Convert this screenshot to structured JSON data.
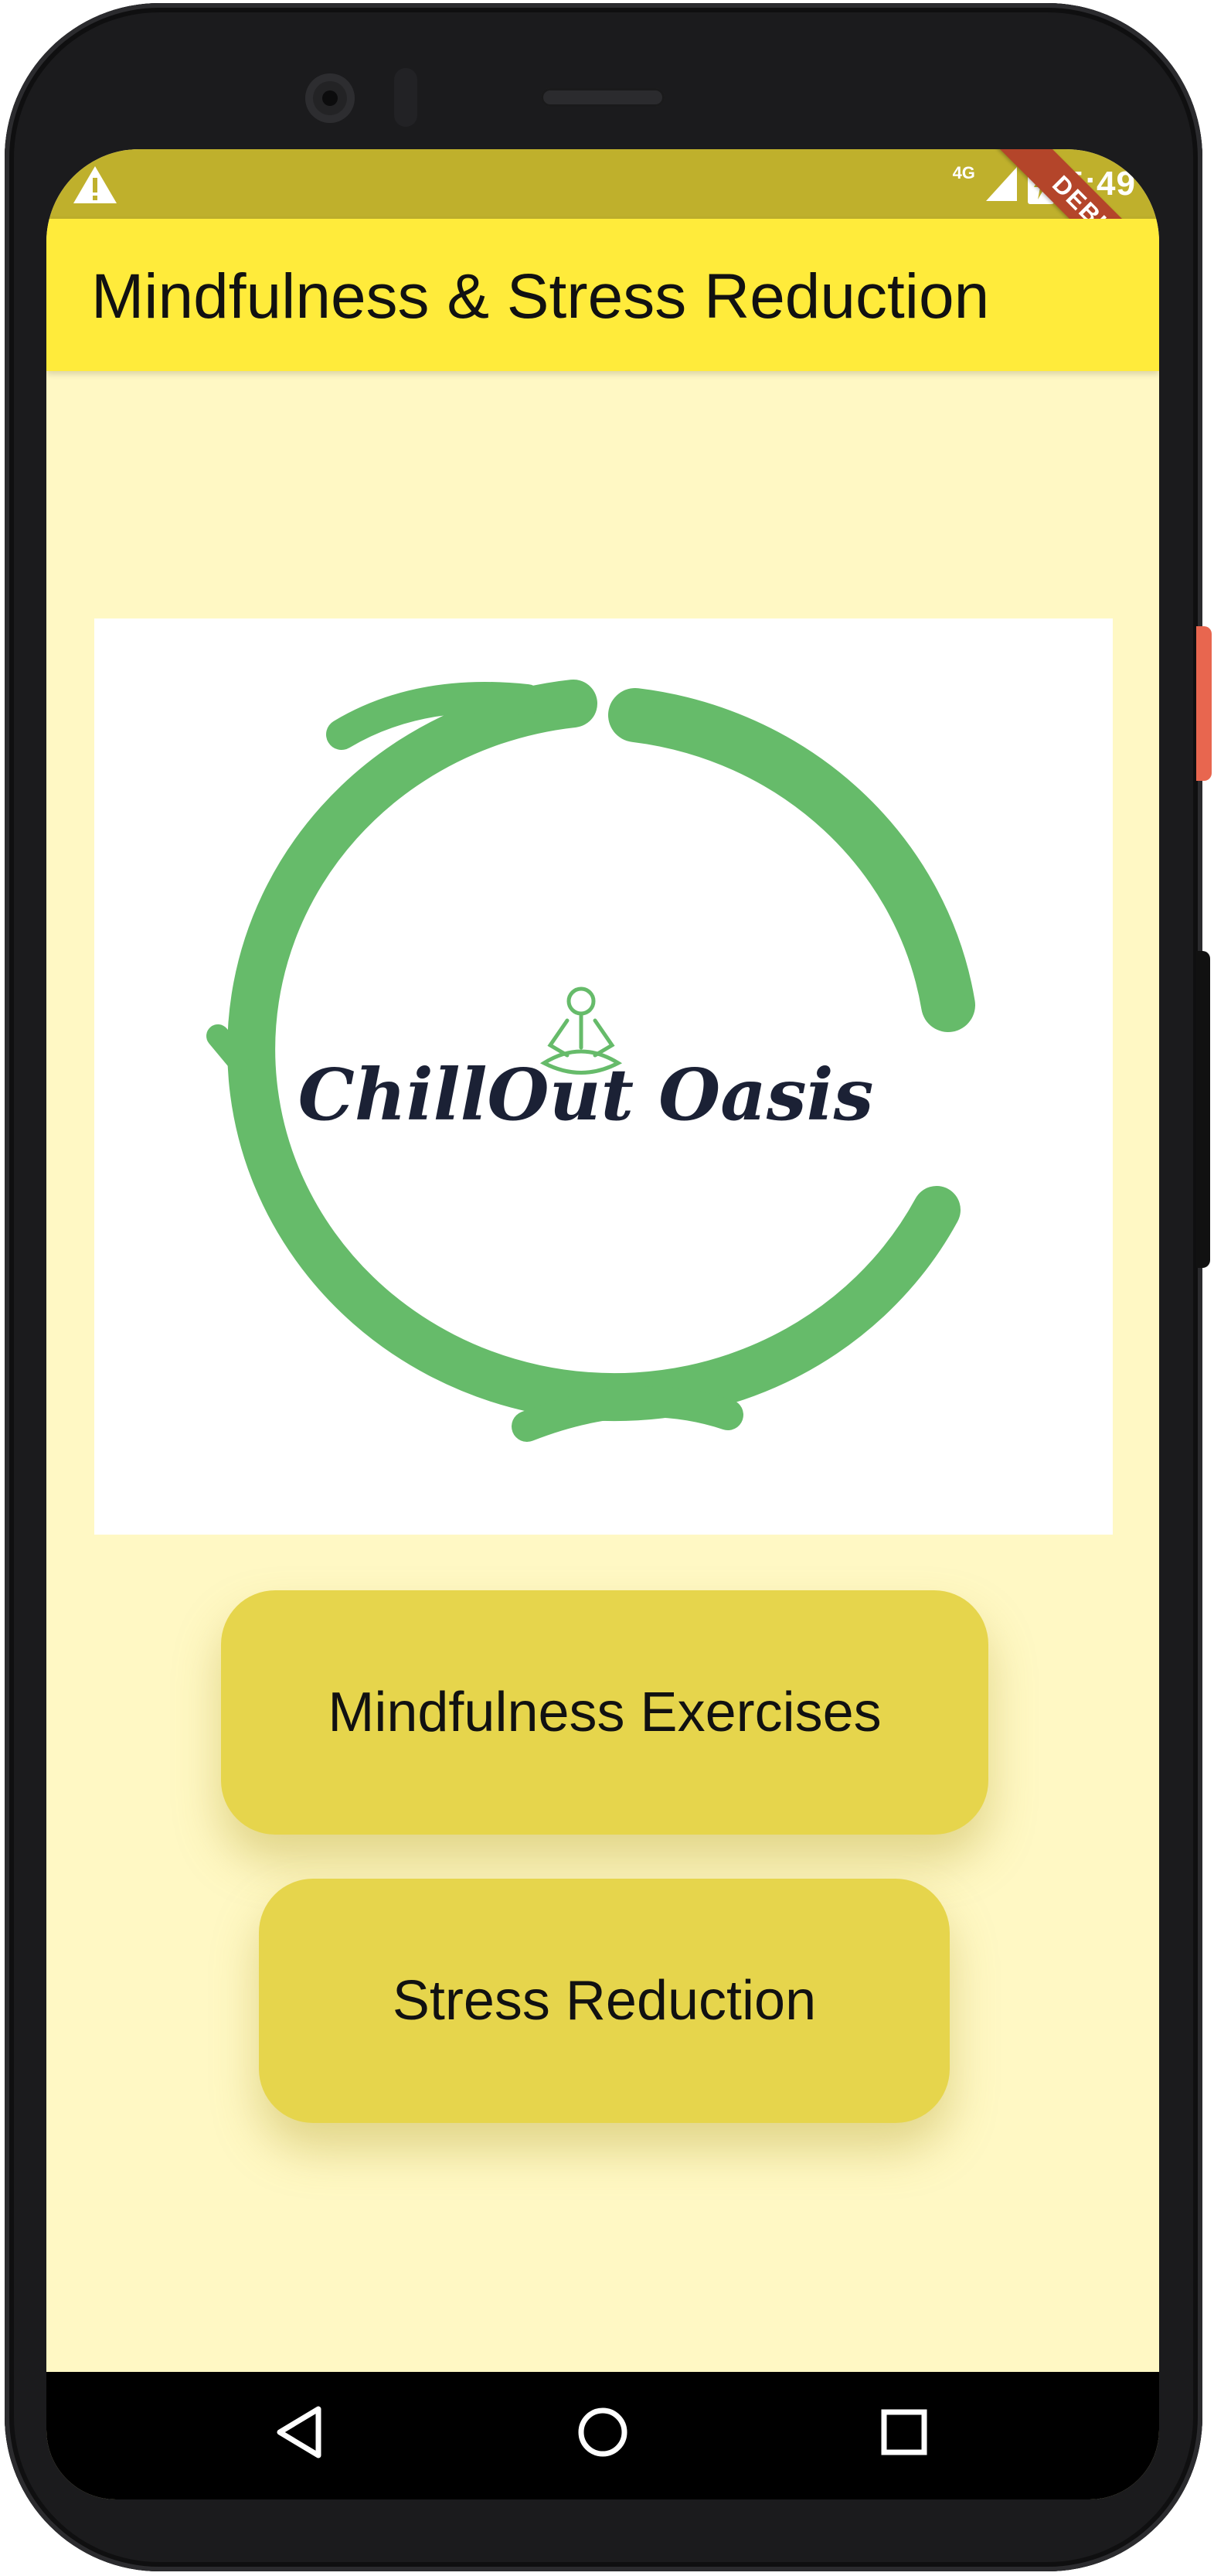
{
  "status_bar": {
    "warning_icon": "warning-triangle-icon",
    "network_type": "4G",
    "signal_icon": "cellular-signal-icon",
    "battery_icon": "battery-charging-icon",
    "time": "5:49",
    "debug_banner": "DEBUG"
  },
  "app_bar": {
    "title": "Mindfulness & Stress Reduction",
    "background_color": "#ffeb3b"
  },
  "logo": {
    "brand_name": "ChillOut Oasis",
    "ring_color": "#66bb6a",
    "figure_icon": "meditating-person-icon"
  },
  "actions": {
    "mindfulness_label": "Mindfulness Exercises",
    "stress_label": "Stress Reduction",
    "button_color": "#e6d54c"
  },
  "nav_bar": {
    "back_icon": "back-triangle-icon",
    "home_icon": "home-circle-icon",
    "recents_icon": "recents-square-icon"
  },
  "theme": {
    "screen_background": "#fff8c4",
    "status_bar_color": "#bfb02c"
  }
}
